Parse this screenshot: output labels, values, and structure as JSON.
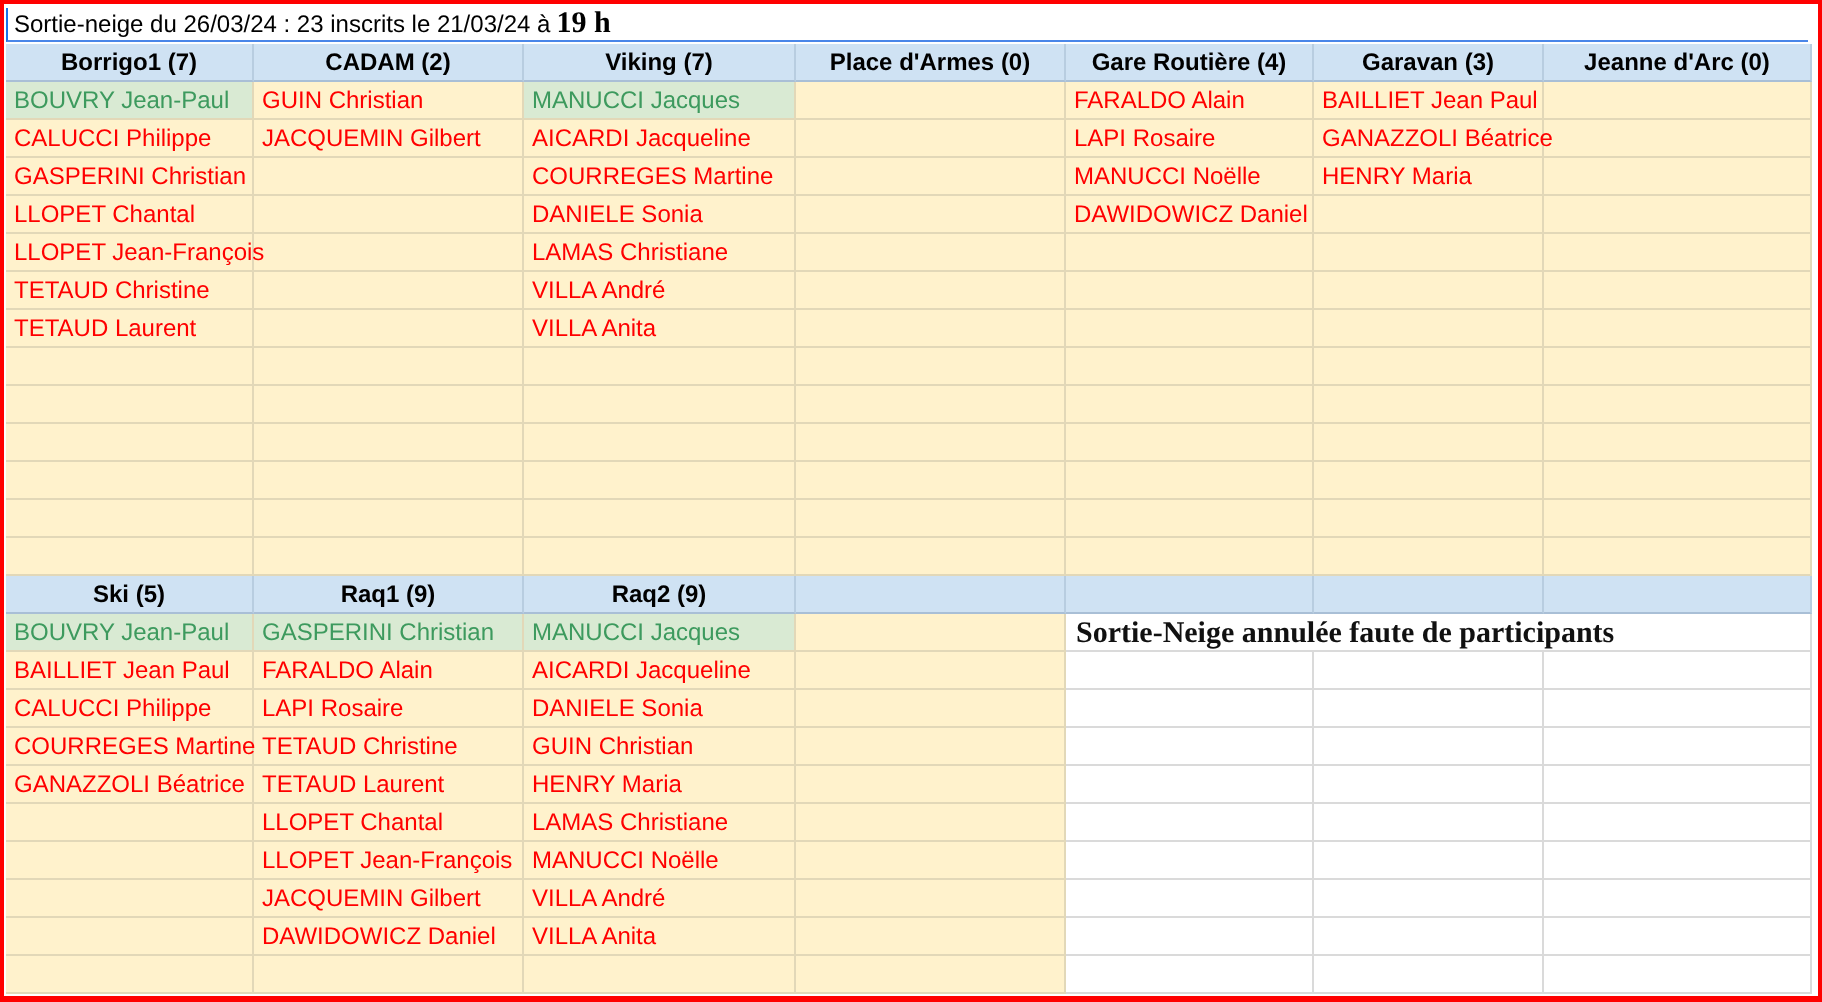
{
  "title": {
    "text": "Sortie-neige du 26/03/24 : 23 inscrits le 21/03/24 à",
    "time": "19 h"
  },
  "sections": [
    {
      "columns": [
        {
          "header": "Borrigo1 (7)",
          "cells": [
            {
              "text": "BOUVRY Jean-Paul",
              "highlighted": true
            },
            {
              "text": "CALUCCI Philippe",
              "highlighted": false
            },
            {
              "text": "GASPERINI Christian",
              "highlighted": false
            },
            {
              "text": "LLOPET Chantal",
              "highlighted": false
            },
            {
              "text": "LLOPET Jean-François",
              "highlighted": false
            },
            {
              "text": "TETAUD Christine",
              "highlighted": false
            },
            {
              "text": "TETAUD Laurent",
              "highlighted": false
            }
          ]
        },
        {
          "header": "CADAM (2)",
          "cells": [
            {
              "text": "GUIN Christian",
              "highlighted": false
            },
            {
              "text": "JACQUEMIN Gilbert",
              "highlighted": false
            }
          ]
        },
        {
          "header": "Viking (7)",
          "cells": [
            {
              "text": "MANUCCI Jacques",
              "highlighted": true
            },
            {
              "text": "AICARDI Jacqueline",
              "highlighted": false
            },
            {
              "text": "COURREGES Martine",
              "highlighted": false
            },
            {
              "text": "DANIELE Sonia",
              "highlighted": false
            },
            {
              "text": "LAMAS Christiane",
              "highlighted": false
            },
            {
              "text": "VILLA André",
              "highlighted": false
            },
            {
              "text": "VILLA Anita",
              "highlighted": false
            }
          ]
        },
        {
          "header": "Place d'Armes (0)"
        },
        {
          "header": "Gare Routière (4)",
          "cells": [
            {
              "text": "FARALDO Alain",
              "highlighted": false
            },
            {
              "text": "LAPI Rosaire",
              "highlighted": false
            },
            {
              "text": "MANUCCI Noëlle",
              "highlighted": false
            },
            {
              "text": "DAWIDOWICZ Daniel",
              "highlighted": false
            }
          ]
        },
        {
          "header": "Garavan (3)",
          "cells": [
            {
              "text": "BAILLIET Jean Paul",
              "highlighted": false
            },
            {
              "text": "GANAZZOLI Béatrice",
              "highlighted": false
            },
            {
              "text": "HENRY Maria",
              "highlighted": false
            }
          ]
        },
        {
          "header": "Jeanne d'Arc (0)"
        }
      ]
    },
    {
      "columns": [
        {
          "header": "Ski (5)",
          "cells": [
            {
              "text": "BOUVRY Jean-Paul",
              "highlighted": true
            },
            {
              "text": "BAILLIET Jean Paul",
              "highlighted": false
            },
            {
              "text": "CALUCCI Philippe",
              "highlighted": false
            },
            {
              "text": "COURREGES Martine",
              "highlighted": false
            },
            {
              "text": "GANAZZOLI Béatrice",
              "highlighted": false
            }
          ]
        },
        {
          "header": "Raq1 (9)",
          "cells": [
            {
              "text": "GASPERINI Christian",
              "highlighted": true
            },
            {
              "text": "FARALDO Alain",
              "highlighted": false
            },
            {
              "text": "LAPI Rosaire",
              "highlighted": false
            },
            {
              "text": "TETAUD Christine",
              "highlighted": false
            },
            {
              "text": "TETAUD Laurent",
              "highlighted": false
            },
            {
              "text": "LLOPET Chantal",
              "highlighted": false
            },
            {
              "text": "LLOPET Jean-François",
              "highlighted": false
            },
            {
              "text": "JACQUEMIN Gilbert",
              "highlighted": false
            },
            {
              "text": "DAWIDOWICZ Daniel",
              "highlighted": false
            }
          ]
        },
        {
          "header": "Raq2 (9)",
          "cells": [
            {
              "text": "MANUCCI Jacques",
              "highlighted": true
            },
            {
              "text": "AICARDI Jacqueline",
              "highlighted": false
            },
            {
              "text": "DANIELE Sonia",
              "highlighted": false
            },
            {
              "text": "GUIN Christian",
              "highlighted": false
            },
            {
              "text": "HENRY Maria",
              "highlighted": false
            },
            {
              "text": "LAMAS Christiane",
              "highlighted": false
            },
            {
              "text": "MANUCCI Noëlle",
              "highlighted": false
            },
            {
              "text": "VILLA André",
              "highlighted": false
            },
            {
              "text": "VILLA Anita",
              "highlighted": false
            }
          ]
        }
      ],
      "notice": "Sortie-Neige annulée faute de participants"
    }
  ]
}
